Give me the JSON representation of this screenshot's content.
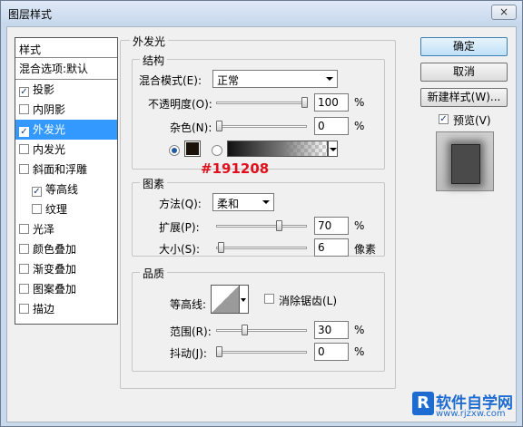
{
  "window": {
    "title": "图层样式",
    "close_glyph": "×"
  },
  "style_list": {
    "header": "样式",
    "blend_item": "混合选项:默认",
    "items": [
      {
        "label": "投影",
        "checked": true,
        "selected": false,
        "indent": false
      },
      {
        "label": "内阴影",
        "checked": false,
        "selected": false,
        "indent": false
      },
      {
        "label": "外发光",
        "checked": true,
        "selected": true,
        "indent": false
      },
      {
        "label": "内发光",
        "checked": false,
        "selected": false,
        "indent": false
      },
      {
        "label": "斜面和浮雕",
        "checked": false,
        "selected": false,
        "indent": false
      },
      {
        "label": "等高线",
        "checked": true,
        "selected": false,
        "indent": true
      },
      {
        "label": "纹理",
        "checked": false,
        "selected": false,
        "indent": true
      },
      {
        "label": "光泽",
        "checked": false,
        "selected": false,
        "indent": false
      },
      {
        "label": "颜色叠加",
        "checked": false,
        "selected": false,
        "indent": false
      },
      {
        "label": "渐变叠加",
        "checked": false,
        "selected": false,
        "indent": false
      },
      {
        "label": "图案叠加",
        "checked": false,
        "selected": false,
        "indent": false
      },
      {
        "label": "描边",
        "checked": false,
        "selected": false,
        "indent": false
      }
    ]
  },
  "outer_glow": {
    "title": "外发光",
    "structure": {
      "title": "结构",
      "blend_mode_label": "混合模式(E):",
      "blend_mode_value": "正常",
      "opacity_label": "不透明度(O):",
      "opacity_value": "100",
      "opacity_unit": "%",
      "opacity_fraction": 1.0,
      "noise_label": "杂色(N):",
      "noise_value": "0",
      "noise_unit": "%",
      "noise_fraction": 0.0,
      "color_hex": "#191208",
      "annotation": "#191208"
    },
    "elements": {
      "title": "图素",
      "technique_label": "方法(Q):",
      "technique_value": "柔和",
      "spread_label": "扩展(P):",
      "spread_value": "70",
      "spread_unit": "%",
      "spread_fraction": 0.7,
      "size_label": "大小(S):",
      "size_value": "6",
      "size_unit": "像素",
      "size_fraction": 0.024
    },
    "quality": {
      "title": "品质",
      "contour_label": "等高线:",
      "antialias_label": "消除锯齿(L)",
      "antialias_checked": false,
      "range_label": "范围(R):",
      "range_value": "30",
      "range_unit": "%",
      "range_fraction": 0.3,
      "jitter_label": "抖动(J):",
      "jitter_value": "0",
      "jitter_unit": "%",
      "jitter_fraction": 0.0
    }
  },
  "buttons": {
    "ok": "确定",
    "cancel": "取消",
    "new_style": "新建样式(W)...",
    "preview_label": "预览(V)",
    "preview_checked": true
  },
  "watermark": {
    "logo_text": "软件自学网",
    "url": "www.rjzxw.com"
  },
  "colors": {
    "selection": "#3399ff",
    "annotation": "#e0101e",
    "swatch": "#191208"
  }
}
